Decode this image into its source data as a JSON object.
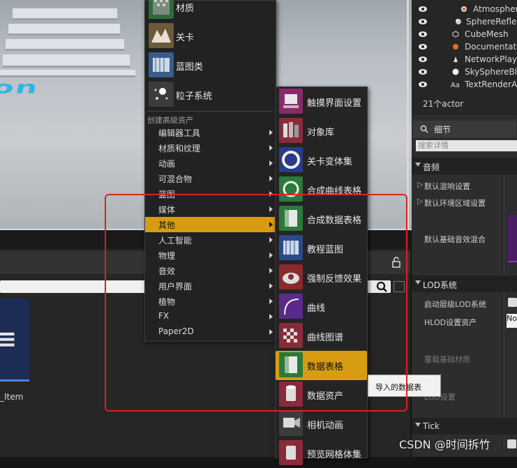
{
  "viewport": {
    "floor_text": "on"
  },
  "content_browser": {
    "asset_label": "_Item"
  },
  "outliner": {
    "items": [
      {
        "label": "Atmospheri",
        "icon": "atmosphere-icon"
      },
      {
        "label": "SphereRefle",
        "icon": "sphere-reflection-icon"
      },
      {
        "label": "CubeMesh",
        "icon": "static-mesh-icon"
      },
      {
        "label": "Documentatio",
        "icon": "documentation-icon"
      },
      {
        "label": "NetworkPlaye",
        "icon": "player-start-icon"
      },
      {
        "label": "SkySphereBlu",
        "icon": "sphere-icon"
      },
      {
        "label": "TextRenderAc",
        "icon": "text-render-icon"
      }
    ],
    "actor_count": "21个actor"
  },
  "details": {
    "tab_label": "细节",
    "search_placeholder": "搜索详情",
    "audio_section": "音频",
    "audio_rows": [
      "默认混响设置",
      "默认环境区域设置",
      "默认基础音效混合"
    ],
    "lod_section": "LOD系统",
    "lod_rows": [
      "启动层级LOD系统",
      "HLOD设置资产",
      "覆载基础材质",
      "LOD设置"
    ],
    "hlod_value": "No",
    "tick_section": "Tick"
  },
  "menu": {
    "top_items": [
      {
        "label": "材质",
        "icon": "material-icon",
        "color": "#2e6b3a"
      },
      {
        "label": "关卡",
        "icon": "level-icon",
        "color": "#6b5a3a"
      },
      {
        "label": "蓝图类",
        "icon": "blueprint-class-icon",
        "color": "#3a5c8a"
      },
      {
        "label": "粒子系统",
        "icon": "particle-system-icon",
        "color": "#3c3c3c"
      }
    ],
    "advanced_header": "创建高级资产",
    "sub_items": [
      {
        "label": "编辑器工具"
      },
      {
        "label": "材质和纹理"
      },
      {
        "label": "动画"
      },
      {
        "label": "可混合物"
      },
      {
        "label": "蓝图"
      },
      {
        "label": "媒体"
      },
      {
        "label": "其他",
        "active": true
      },
      {
        "label": "人工智能"
      },
      {
        "label": "物理"
      },
      {
        "label": "音效"
      },
      {
        "label": "用户界面"
      },
      {
        "label": "植物"
      },
      {
        "label": "FX"
      },
      {
        "label": "Paper2D"
      }
    ]
  },
  "submenu": {
    "items": [
      {
        "label": "触摸界面设置",
        "icon": "touch-interface-icon",
        "accent": "#8a2a6a"
      },
      {
        "label": "对象库",
        "icon": "object-library-icon",
        "accent": "#8a2a3a"
      },
      {
        "label": "关卡变体集",
        "icon": "level-variant-sets-icon",
        "accent": "#2a3a8a"
      },
      {
        "label": "合成曲线表格",
        "icon": "composite-curve-table-icon",
        "accent": "#2a7a3a"
      },
      {
        "label": "合成数据表格",
        "icon": "composite-data-table-icon",
        "accent": "#2a7a3a"
      },
      {
        "label": "教程蓝图",
        "icon": "tutorial-blueprint-icon",
        "accent": "#2a4a8a"
      },
      {
        "label": "强制反馈效果",
        "icon": "force-feedback-icon",
        "accent": "#8a2a2a"
      },
      {
        "label": "曲线",
        "icon": "curve-icon",
        "accent": "#5a2a8a"
      },
      {
        "label": "曲线图谱",
        "icon": "curve-atlas-icon",
        "accent": "#8a2a3a"
      },
      {
        "label": "数据表格",
        "icon": "data-table-icon",
        "accent": "#2a7a3a",
        "active": true
      },
      {
        "label": "数据资产",
        "icon": "data-asset-icon",
        "accent": "#8a2a3a"
      },
      {
        "label": "相机动画",
        "icon": "camera-animation-icon",
        "accent": "#3c3c3c"
      },
      {
        "label": "预览网格体集",
        "icon": "preview-mesh-collection-icon",
        "accent": "#8a2a3a"
      }
    ]
  },
  "tooltip": {
    "text": "导入的数据表"
  },
  "watermark": "CSDN @时间拆竹"
}
